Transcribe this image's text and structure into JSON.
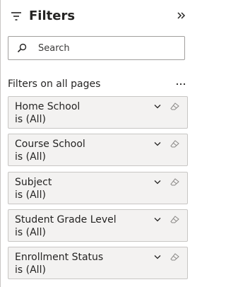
{
  "header": {
    "title": "Filters"
  },
  "search": {
    "placeholder": "Search"
  },
  "section": {
    "title": "Filters on all pages"
  },
  "filters": [
    {
      "name": "Home School",
      "value": "is (All)"
    },
    {
      "name": "Course School",
      "value": "is (All)"
    },
    {
      "name": "Subject",
      "value": "is (All)"
    },
    {
      "name": "Student Grade Level",
      "value": "is (All)"
    },
    {
      "name": "Enrollment Status",
      "value": "is (All)"
    }
  ],
  "icons": {
    "filter": "filter-icon",
    "collapse": "double-chevron-right-icon",
    "search": "search-icon",
    "more": "more-options-icon",
    "expand": "chevron-down-icon",
    "clear": "eraser-icon"
  }
}
